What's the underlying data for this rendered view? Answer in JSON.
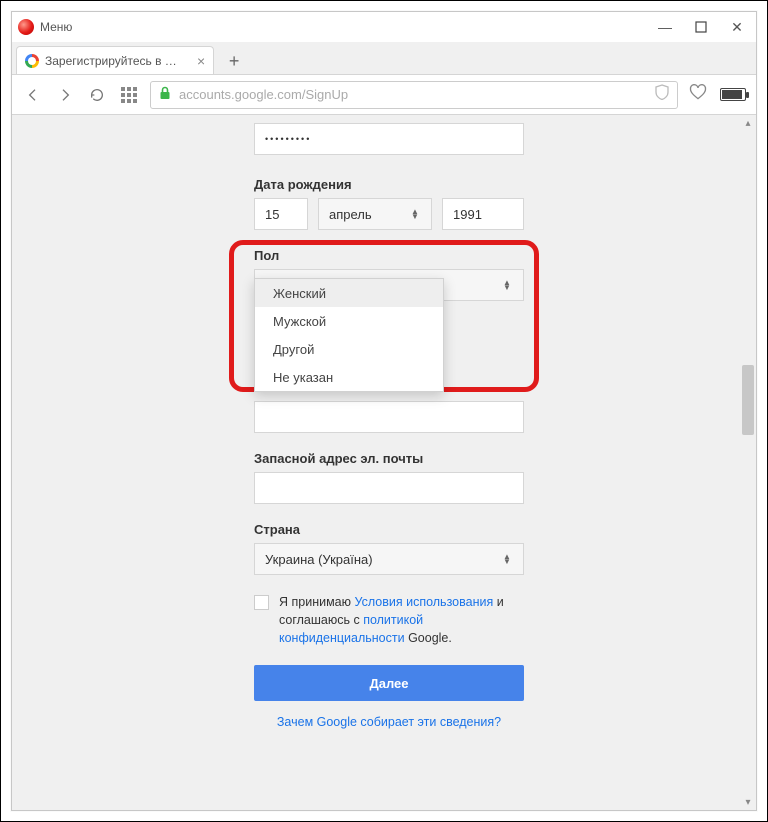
{
  "window": {
    "menu": "Меню",
    "minimize": "—",
    "maximize": "◻",
    "close": "✕"
  },
  "tabs": {
    "active": {
      "title": "Зарегистрируйтесь в Goo",
      "close": "×"
    },
    "newtab": "+"
  },
  "toolbar": {
    "url": "accounts.google.com/SignUp"
  },
  "form": {
    "password_mask": "•••••••••",
    "dob": {
      "label": "Дата рождения",
      "day": "15",
      "month": "апрель",
      "year": "1991"
    },
    "gender": {
      "label": "Пол",
      "options": [
        "Женский",
        "Мужской",
        "Другой",
        "Не указан"
      ],
      "highlighted_index": 0
    },
    "backup_email": {
      "label": "Запасной адрес эл. почты"
    },
    "country": {
      "label": "Страна",
      "value": "Украина (Україна)"
    },
    "agree": {
      "prefix": "Я принимаю ",
      "terms": "Условия использования",
      "mid": " и соглашаюсь с ",
      "privacy": "политикой конфиденциальности",
      "suffix": " Google."
    },
    "submit": "Далее",
    "why": "Зачем Google собирает эти сведения?"
  }
}
